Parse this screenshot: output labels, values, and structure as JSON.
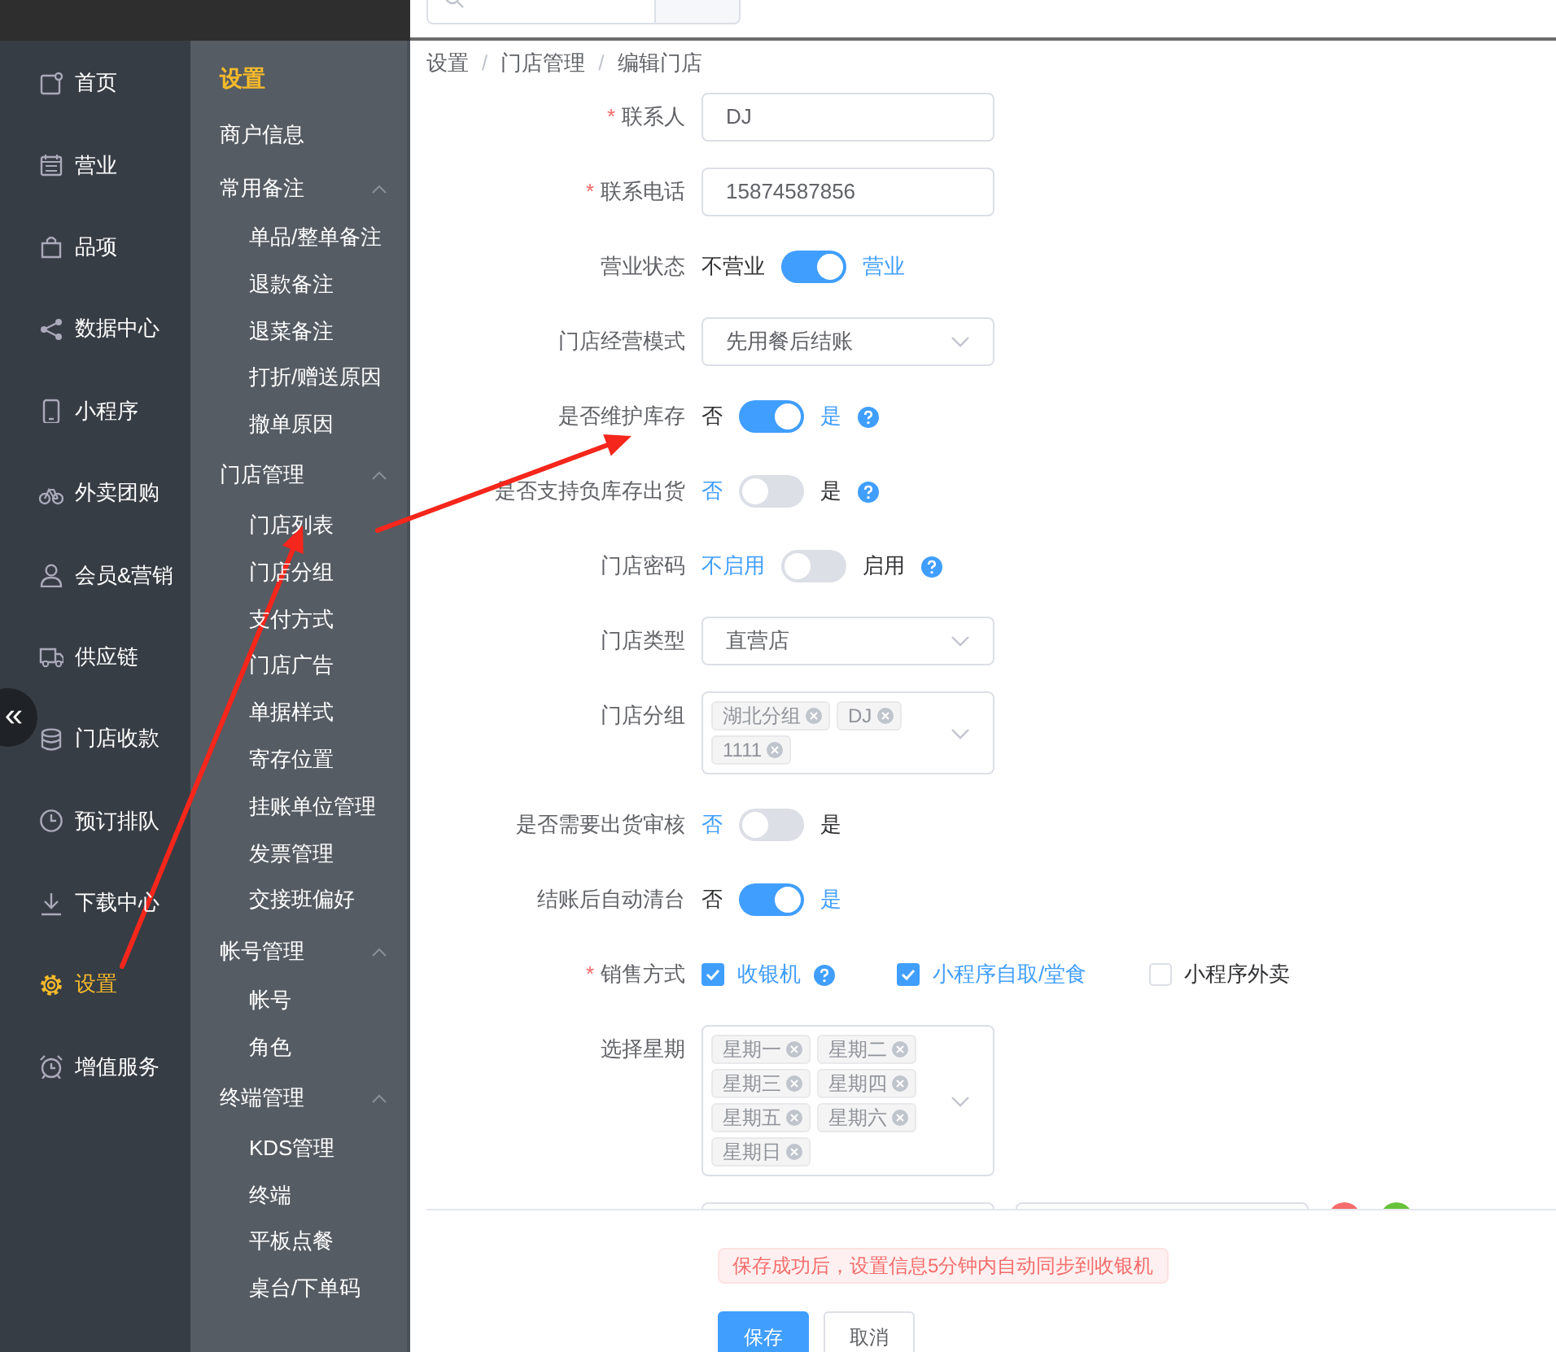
{
  "sidebar": {
    "collapse_icon": "«",
    "items": [
      {
        "label": "首页",
        "selected": false
      },
      {
        "label": "营业",
        "selected": false
      },
      {
        "label": "品项",
        "selected": false
      },
      {
        "label": "数据中心",
        "selected": false
      },
      {
        "label": "小程序",
        "selected": false
      },
      {
        "label": "外卖团购",
        "selected": false
      },
      {
        "label": "会员&营销",
        "selected": false
      },
      {
        "label": "供应链",
        "selected": false
      },
      {
        "label": "门店收款",
        "selected": false
      },
      {
        "label": "预订排队",
        "selected": false
      },
      {
        "label": "下载中心",
        "selected": false
      },
      {
        "label": "设置",
        "selected": true
      },
      {
        "label": "增值服务",
        "selected": false
      }
    ]
  },
  "submenu": {
    "title": "设置",
    "groups": [
      {
        "label": "商户信息"
      },
      {
        "label": "常用备注",
        "expanded": true,
        "children": [
          "单品/整单备注",
          "退款备注",
          "退菜备注",
          "打折/赠送原因",
          "撤单原因"
        ]
      },
      {
        "label": "门店管理",
        "expanded": true,
        "children": [
          "门店列表",
          "门店分组",
          "支付方式",
          "门店广告",
          "单据样式",
          "寄存位置",
          "挂账单位管理",
          "发票管理",
          "交接班偏好"
        ]
      },
      {
        "label": "帐号管理",
        "expanded": true,
        "children": [
          "帐号",
          "角色"
        ]
      },
      {
        "label": "终端管理",
        "expanded": true,
        "children": [
          "KDS管理",
          "终端",
          "平板点餐",
          "桌台/下单码"
        ]
      }
    ]
  },
  "breadcrumb": {
    "separator": "/",
    "items": [
      "设置",
      "门店管理",
      "编辑门店"
    ]
  },
  "form": {
    "rows": [
      {
        "kind": "input",
        "label": "联系人",
        "required_mark": "*",
        "value": "DJ"
      },
      {
        "kind": "input",
        "label": "联系电话",
        "required_mark": "*",
        "value": "15874587856"
      },
      {
        "kind": "switch",
        "label": "营业状态",
        "off_label": "不营业",
        "on_label": "营业",
        "on": true
      },
      {
        "kind": "select",
        "label": "门店经营模式",
        "value": "先用餐后结账"
      },
      {
        "kind": "switch",
        "label": "是否维护库存",
        "off_label": "否",
        "on_label": "是",
        "on": true,
        "help": true
      },
      {
        "kind": "switch",
        "label": "是否支持负库存出货",
        "off_label": "否",
        "on_label": "是",
        "on": false,
        "help": true
      },
      {
        "kind": "switch",
        "label": "门店密码",
        "off_label": "不启用",
        "on_label": "启用",
        "on": false,
        "help": true
      },
      {
        "kind": "select",
        "label": "门店类型",
        "value": "直营店"
      },
      {
        "kind": "tags",
        "label": "门店分组",
        "tags": [
          "湖北分组",
          "DJ",
          "1111"
        ]
      },
      {
        "kind": "switch",
        "label": "是否需要出货审核",
        "off_label": "否",
        "on_label": "是",
        "on": false
      },
      {
        "kind": "switch",
        "label": "结账后自动清台",
        "off_label": "否",
        "on_label": "是",
        "on": true
      },
      {
        "kind": "checkboxes",
        "label": "销售方式",
        "required_mark": "*",
        "options": [
          {
            "label": "收银机",
            "checked": true,
            "help": true
          },
          {
            "label": "小程序自取/堂食",
            "checked": true
          },
          {
            "label": "小程序外卖",
            "checked": false
          }
        ]
      },
      {
        "kind": "tags",
        "label": "选择星期",
        "tags": [
          "星期一",
          "星期二",
          "星期三",
          "星期四",
          "星期五",
          "星期六",
          "星期日"
        ]
      },
      {
        "kind": "input_pair"
      }
    ]
  },
  "footer": {
    "notice": "保存成功后，设置信息5分钟内自动同步到收银机",
    "buttons": [
      {
        "label": "保存",
        "kind": "primary"
      },
      {
        "label": "取消",
        "kind": "default"
      }
    ]
  }
}
